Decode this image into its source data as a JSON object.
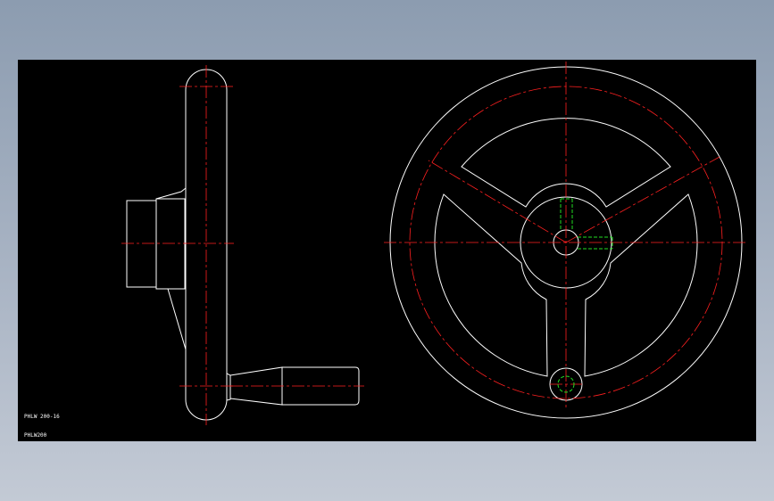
{
  "drawing": {
    "label_primary": "PHLW 200-16",
    "label_secondary": "PHLW200"
  },
  "colors": {
    "background": "#000000",
    "outline": "#ffffff",
    "centerline": "#ff2020",
    "hidden_line": "#22dd22",
    "frame": "#a9b4c4"
  }
}
